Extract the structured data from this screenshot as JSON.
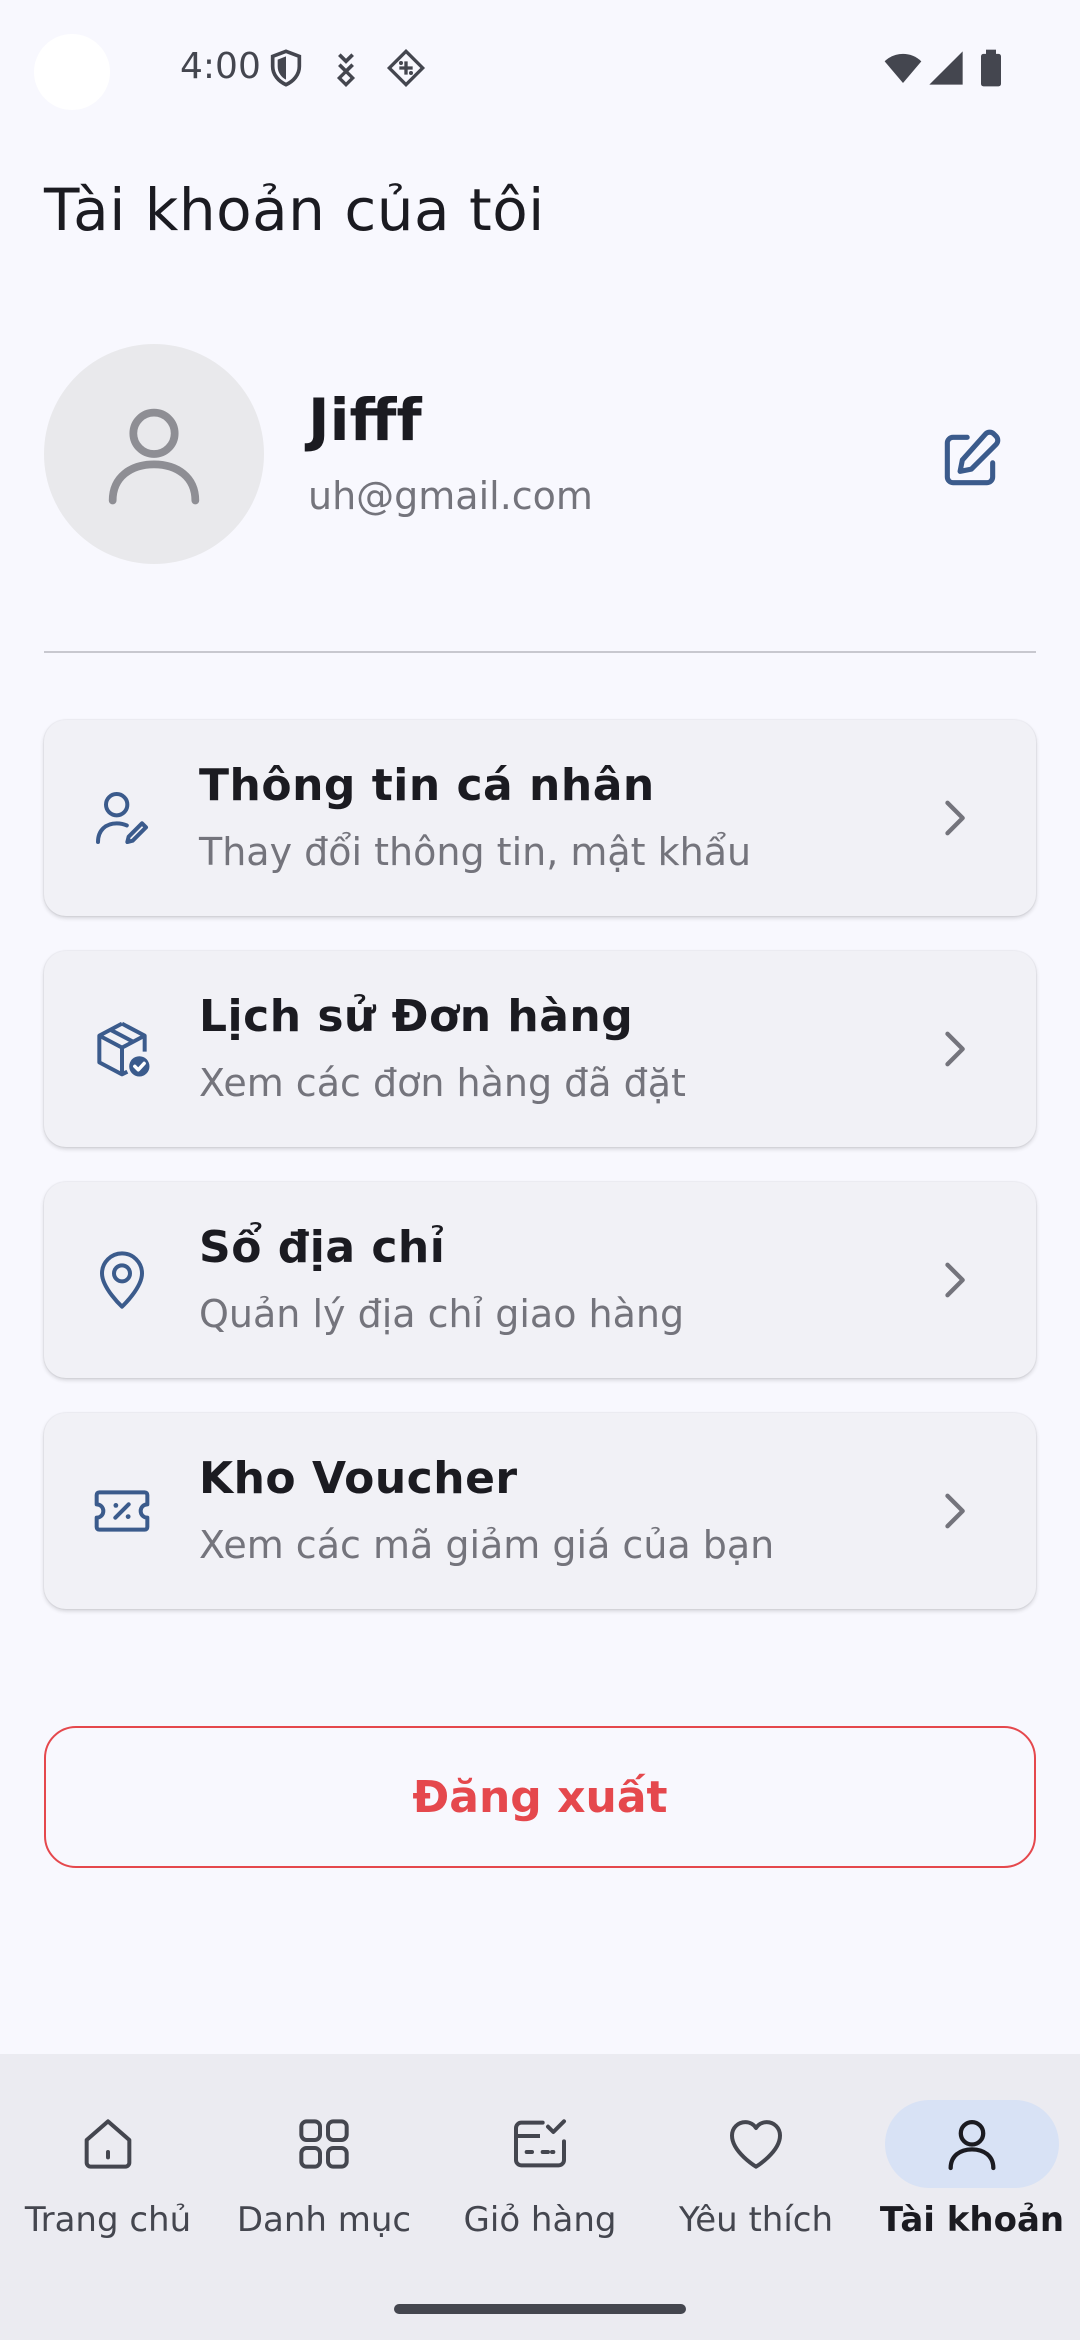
{
  "status_bar": {
    "time": "4:00",
    "icons": [
      "shield-icon",
      "download-icon",
      "game-icon",
      "wifi-icon",
      "signal-icon",
      "battery-icon"
    ]
  },
  "header": {
    "title": "Tài khoản của tôi"
  },
  "profile": {
    "name": "Jifff",
    "email": "uh@gmail.com",
    "avatar_icon": "person-icon",
    "edit_icon": "edit-icon"
  },
  "menu": {
    "items": [
      {
        "title": "Thông tin cá nhân",
        "subtitle": "Thay đổi thông tin, mật khẩu",
        "icon": "user-edit-icon"
      },
      {
        "title": "Lịch sử Đơn hàng",
        "subtitle": "Xem các đơn hàng đã đặt",
        "icon": "package-check-icon"
      },
      {
        "title": "Sổ địa chỉ",
        "subtitle": "Quản lý địa chỉ giao hàng",
        "icon": "location-pin-icon"
      },
      {
        "title": "Kho Voucher",
        "subtitle": "Xem các mã giảm giá của bạn",
        "icon": "voucher-icon"
      }
    ]
  },
  "logout": {
    "label": "Đăng xuất"
  },
  "bottom_nav": {
    "items": [
      {
        "label": "Trang chủ",
        "icon": "home-icon",
        "active": false
      },
      {
        "label": "Danh mục",
        "icon": "grid-icon",
        "active": false
      },
      {
        "label": "Giỏ hàng",
        "icon": "cart-icon",
        "active": false
      },
      {
        "label": "Yêu thích",
        "icon": "heart-icon",
        "active": false
      },
      {
        "label": "Tài khoản",
        "icon": "account-icon",
        "active": true
      }
    ]
  },
  "colors": {
    "background": "#f8f8fe",
    "card": "#f1f1f6",
    "accent_icon": "#3b5b8c",
    "logout": "#e5484d",
    "nav_active_pill": "#d8e2f5"
  }
}
